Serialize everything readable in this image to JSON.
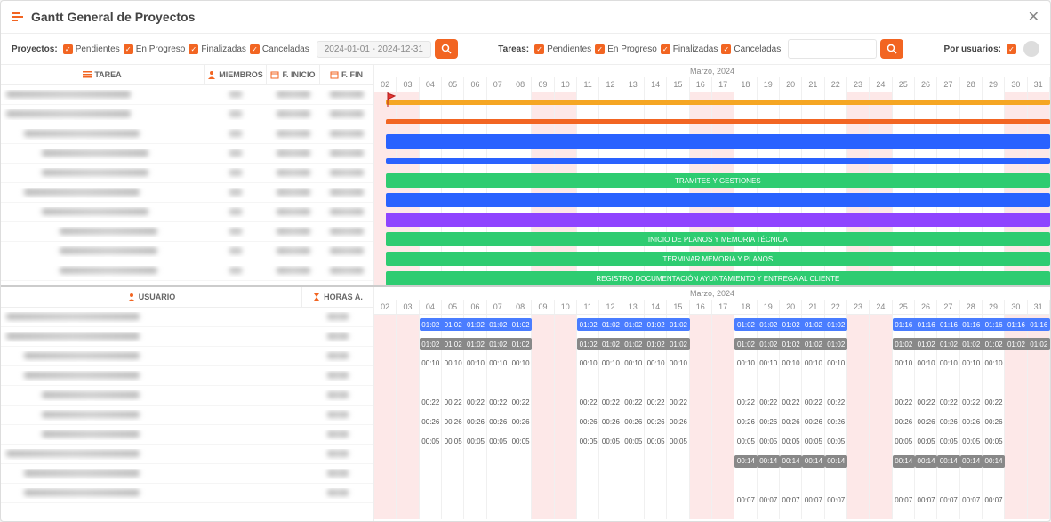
{
  "title": "Gantt General de Proyectos",
  "filters": {
    "proyectos_label": "Proyectos:",
    "tareas_label": "Tareas:",
    "por_usuarios_label": "Por usuarios:",
    "statuses": [
      "Pendientes",
      "En Progreso",
      "Finalizadas",
      "Canceladas"
    ],
    "date_range": "2024-01-01 - 2024-12-31"
  },
  "columns_top": {
    "tarea": "TAREA",
    "miembros": "MIEMBROS",
    "f_inicio": "F. INICIO",
    "f_fin": "F. FIN"
  },
  "columns_bottom": {
    "usuario": "USUARIO",
    "horas": "HORAS A."
  },
  "month_label": "Marzo, 2024",
  "days": [
    "02",
    "03",
    "04",
    "05",
    "06",
    "07",
    "08",
    "09",
    "10",
    "11",
    "12",
    "13",
    "14",
    "15",
    "16",
    "17",
    "18",
    "19",
    "20",
    "21",
    "22",
    "23",
    "24",
    "25",
    "26",
    "27",
    "28",
    "29",
    "30",
    "31"
  ],
  "weekend_idx": [
    0,
    1,
    7,
    8,
    14,
    15,
    21,
    22,
    28,
    29
  ],
  "gantt_bars": [
    {
      "row": 0,
      "start": 0.5,
      "end": 30,
      "color": "#f5a623",
      "thin": true
    },
    {
      "row": 1,
      "start": 0.5,
      "end": 30,
      "color": "#f26522",
      "thin": true
    },
    {
      "row": 2,
      "start": 0.5,
      "end": 30,
      "color": "#2962ff"
    },
    {
      "row": 3,
      "start": 0.5,
      "end": 30,
      "color": "#2962ff",
      "thin": true
    },
    {
      "row": 4,
      "start": 0.5,
      "end": 30,
      "color": "#2ecc71",
      "label": "TRAMITES Y GESTIONES"
    },
    {
      "row": 5,
      "start": 0.5,
      "end": 30,
      "color": "#2962ff"
    },
    {
      "row": 6,
      "start": 0.5,
      "end": 30,
      "color": "#8e44ff"
    },
    {
      "row": 7,
      "start": 0.5,
      "end": 30,
      "color": "#2ecc71",
      "label": "INICIO DE PLANOS Y MEMORIA TÉCNICA"
    },
    {
      "row": 8,
      "start": 0.5,
      "end": 30,
      "color": "#2ecc71",
      "label": "TERMINAR MEMORIA Y PLANOS"
    },
    {
      "row": 9,
      "start": 0.5,
      "end": 30,
      "color": "#2ecc71",
      "label": "REGISTRO DOCUMENTACIÓN AYUNTAMIENTO Y ENTREGA AL CLIENTE"
    }
  ],
  "flags": [
    {
      "row": 0,
      "day": 0.5
    },
    {
      "row": 10,
      "day": 18.5
    }
  ],
  "hours_bars": [
    {
      "row": 0,
      "color": "#4a7dff",
      "segments": [
        {
          "start": 1,
          "end": 7,
          "val": "01:02"
        },
        {
          "start": 8,
          "end": 14,
          "val": "01:02"
        },
        {
          "start": 15,
          "end": 21,
          "val": "01:02"
        },
        {
          "start": 23,
          "end": 30,
          "val": "01:16"
        }
      ]
    },
    {
      "row": 1,
      "color": "#888",
      "segments": [
        {
          "start": 1,
          "end": 7,
          "val": "01:02"
        },
        {
          "start": 8,
          "end": 14,
          "val": "01:02"
        },
        {
          "start": 15,
          "end": 21,
          "val": "01:02"
        },
        {
          "start": 23,
          "end": 30,
          "val": "01:02"
        }
      ]
    }
  ],
  "hours_text_rows": [
    {
      "row": 2,
      "val": "00:10"
    },
    {
      "row": 3,
      "val": ""
    },
    {
      "row": 4,
      "val": "00:22"
    },
    {
      "row": 5,
      "val": "00:26"
    },
    {
      "row": 6,
      "val": "00:05"
    },
    {
      "row": 7,
      "val": "00:14",
      "only_last": true,
      "bar": true
    },
    {
      "row": 8,
      "val": ""
    },
    {
      "row": 9,
      "val": "00:07",
      "only_last": true
    }
  ],
  "chart_data": {
    "type": "gantt",
    "month": "Marzo 2024",
    "day_range": [
      2,
      31
    ],
    "tasks": [
      {
        "label": "(project row)",
        "start": "2024-03-02",
        "end": "2024-03-31",
        "color": "orange"
      },
      {
        "label": "(project row)",
        "start": "2024-03-02",
        "end": "2024-03-31",
        "color": "orange-dark"
      },
      {
        "label": "(group)",
        "start": "2024-03-02",
        "end": "2024-03-31",
        "color": "blue"
      },
      {
        "label": "(group)",
        "start": "2024-03-02",
        "end": "2024-03-31",
        "color": "blue"
      },
      {
        "label": "TRAMITES Y GESTIONES",
        "start": "2024-03-02",
        "end": "2024-03-31",
        "color": "green"
      },
      {
        "label": "(group)",
        "start": "2024-03-02",
        "end": "2024-03-31",
        "color": "blue"
      },
      {
        "label": "(group)",
        "start": "2024-03-02",
        "end": "2024-03-31",
        "color": "purple"
      },
      {
        "label": "INICIO DE PLANOS Y MEMORIA TÉCNICA",
        "start": "2024-03-02",
        "end": "2024-03-31",
        "color": "green"
      },
      {
        "label": "TERMINAR MEMORIA Y PLANOS",
        "start": "2024-03-02",
        "end": "2024-03-31",
        "color": "green"
      },
      {
        "label": "REGISTRO DOCUMENTACIÓN AYUNTAMIENTO Y ENTREGA AL CLIENTE",
        "start": "2024-03-02",
        "end": "2024-03-31",
        "color": "green"
      }
    ],
    "user_hours": {
      "weekday_groups": [
        [
          4,
          5,
          6,
          7,
          8
        ],
        [
          11,
          12,
          13,
          14,
          15
        ],
        [
          18,
          19,
          20,
          21,
          22
        ],
        [
          25,
          26,
          27,
          28,
          29
        ]
      ],
      "series": [
        {
          "color": "blue",
          "per_group": [
            "01:02",
            "01:02",
            "01:02",
            "01:16"
          ]
        },
        {
          "color": "grey",
          "per_group": [
            "01:02",
            "01:02",
            "01:02",
            "01:02"
          ]
        },
        {
          "per_weekday": "00:10"
        },
        {
          "per_weekday": "00:22"
        },
        {
          "per_weekday": "00:26"
        },
        {
          "per_weekday": "00:05"
        },
        {
          "last_groups_only": "00:14"
        },
        {
          "last_groups_only": "00:07"
        }
      ]
    }
  }
}
